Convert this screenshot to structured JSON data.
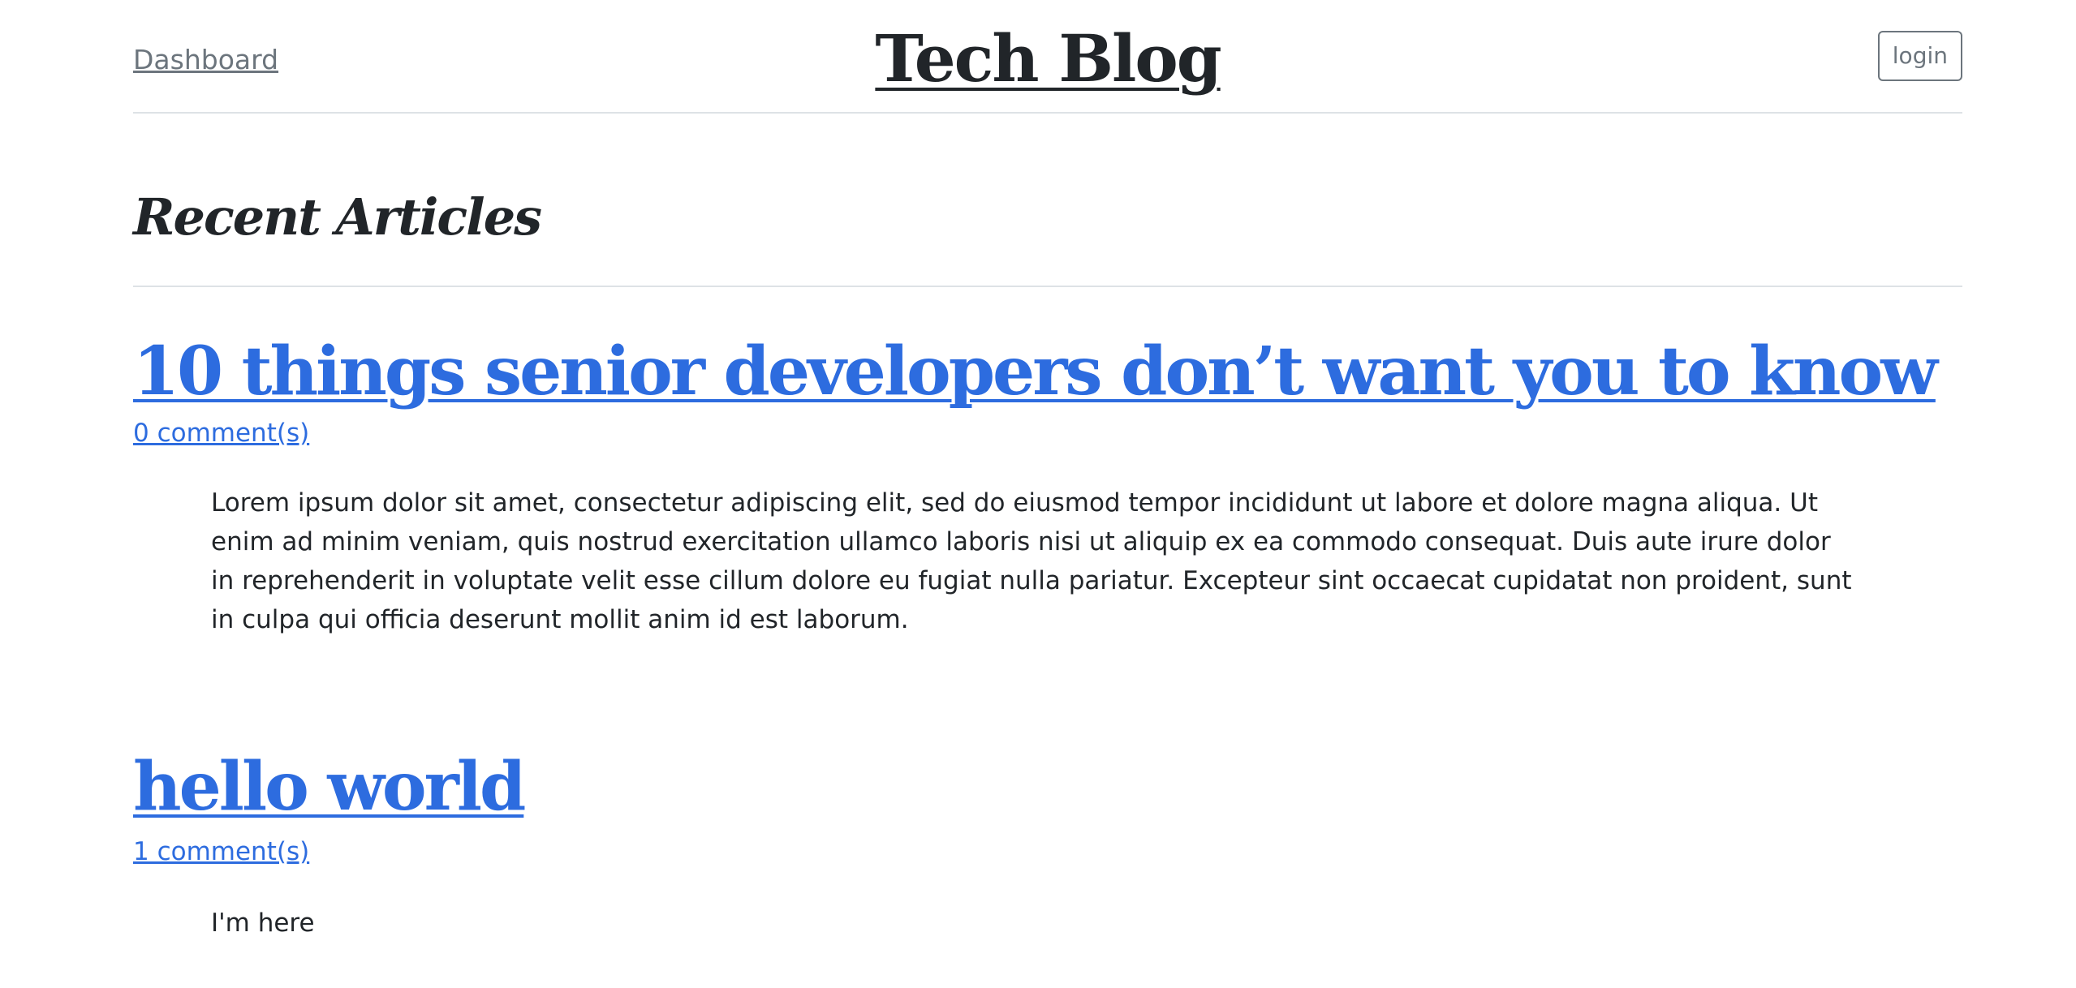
{
  "header": {
    "dashboard_label": "Dashboard",
    "site_title": "Tech Blog",
    "login_label": "login"
  },
  "main": {
    "section_heading": "Recent Articles",
    "articles": [
      {
        "title": "10 things senior developers don’t want you to know",
        "comments": "0 comment(s)",
        "body": "Lorem ipsum dolor sit amet, consectetur adipiscing elit, sed do eiusmod tempor incididunt ut labore et dolore magna aliqua. Ut enim ad minim veniam, quis nostrud exercitation ullamco laboris nisi ut aliquip ex ea commodo consequat. Duis aute irure dolor in reprehenderit in voluptate velit esse cillum dolore eu fugiat nulla pariatur. Excepteur sint occaecat cupidatat non proident, sunt in culpa qui officia deserunt mollit anim id est laborum."
      },
      {
        "title": "hello world",
        "comments": "1 comment(s)",
        "body": "I'm here"
      }
    ]
  },
  "colors": {
    "link": "#2d6cdf",
    "text": "#212529",
    "muted": "#6c757d",
    "divider": "#dee2e6"
  }
}
